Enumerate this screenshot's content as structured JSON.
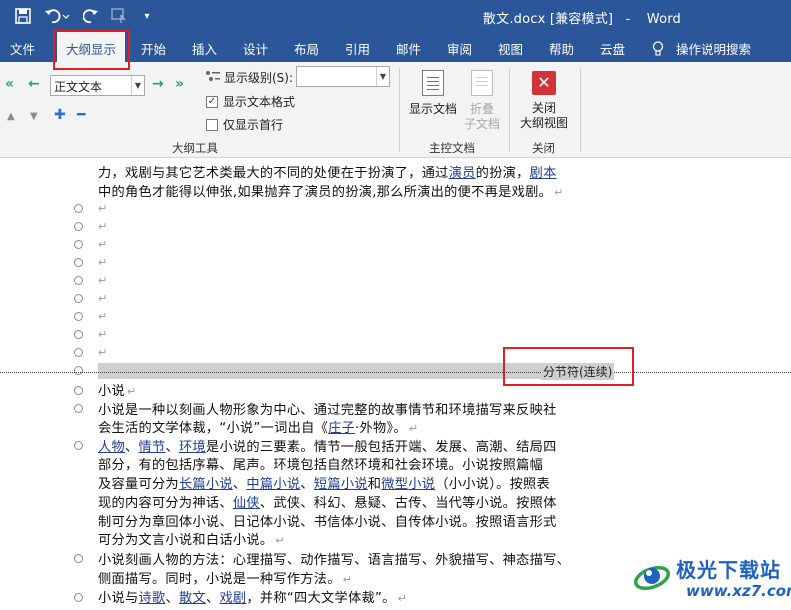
{
  "titlebar": {
    "doc_title": "散文.docx [兼容模式]",
    "separator": "-",
    "app_name": "Word",
    "icons": [
      "save-icon",
      "undo-icon",
      "redo-icon",
      "touch-mode-icon",
      "customize-quick-access-icon"
    ]
  },
  "tabs": [
    "文件",
    "大纲显示",
    "开始",
    "插入",
    "设计",
    "布局",
    "引用",
    "邮件",
    "审阅",
    "视图",
    "帮助",
    "云盘"
  ],
  "active_tab": "大纲显示",
  "tell_me": "操作说明搜索",
  "ribbon": {
    "level_combo_value": "正文文本",
    "show_level_label": "显示级别(S):",
    "show_level_value": "",
    "show_text_format": "显示文本格式",
    "show_text_format_checked": true,
    "show_first_line": "仅显示首行",
    "show_first_line_checked": false,
    "group_outline_tools": "大纲工具",
    "show_document": "显示文档",
    "collapse_sub_1": "折叠",
    "collapse_sub_2": "子文档",
    "group_master_doc": "主控文档",
    "close_outline_1": "关闭",
    "close_outline_2": "大纲视图",
    "group_close": "关闭"
  },
  "document": {
    "line1_a": "力，戏剧与其它艺术类最大的不同的处便在于扮演了，通过",
    "line1_link1": "演员",
    "line1_b": "的扮演，",
    "line1_link2": "剧本",
    "line2": "中的角色才能得以伸张,如果抛弃了演员的扮演,那么所演出的便不再是戏剧。",
    "para_mark": "↵",
    "section_break": "分节符(连续)",
    "p1": "小说",
    "p2_l1": "小说是一种以刻画人物形象为中心、通过完整的故事情节和环境描写来反映社",
    "p2_l2a": "会生活的文学体裁，“小说”一词出自《",
    "p2_l2link": "庄子",
    "p2_l2b": "·外物》。",
    "p3_l1_link1": "人物",
    "p3_l1_sep1": "、",
    "p3_l1_link2": "情节",
    "p3_l1_sep2": "、",
    "p3_l1_link3": "环境",
    "p3_l1_rest": "是小说的三要素。情节一般包括开端、发展、高潮、结局四",
    "p3_l2": "部分，有的包括序幕、尾声。环境包括自然环境和社会环境。小说按照篇幅",
    "p3_l3a": "及容量可分为",
    "p3_l3link1": "长篇小说",
    "p3_l3sep1": "、",
    "p3_l3link2": "中篇小说",
    "p3_l3sep2": "、",
    "p3_l3link3": "短篇小说",
    "p3_l3and": "和",
    "p3_l3link4": "微型小说",
    "p3_l3b": "（小小说）。按照表",
    "p3_l4a": "现的内容可分为神话、",
    "p3_l4link": "仙侠",
    "p3_l4b": "、武侠、科幻、悬疑、古传、当代等小说。按照体",
    "p3_l5": "制可分为章回体小说、日记体小说、书信体小说、自传体小说。按照语言形式",
    "p3_l6": "可分为文言小说和白话小说。",
    "p4_l1": "小说刻画人物的方法：心理描写、动作描写、语言描写、外貌描写、神态描写、",
    "p4_l2": "侧面描写。同时，小说是一种写作方法。",
    "p5_a": "小说与",
    "p5_link1": "诗歌",
    "p5_sep1": "、",
    "p5_link2": "散文",
    "p5_sep2": "、",
    "p5_link3": "戏剧",
    "p5_b": "，并称“四大文学体裁”。"
  },
  "watermark": {
    "text": "极光下载站",
    "url": "www.xz7.com"
  },
  "colors": {
    "ribbon_blue": "#2b579a",
    "highlight_red": "#e02020",
    "link_blue": "#1f3f9a"
  }
}
